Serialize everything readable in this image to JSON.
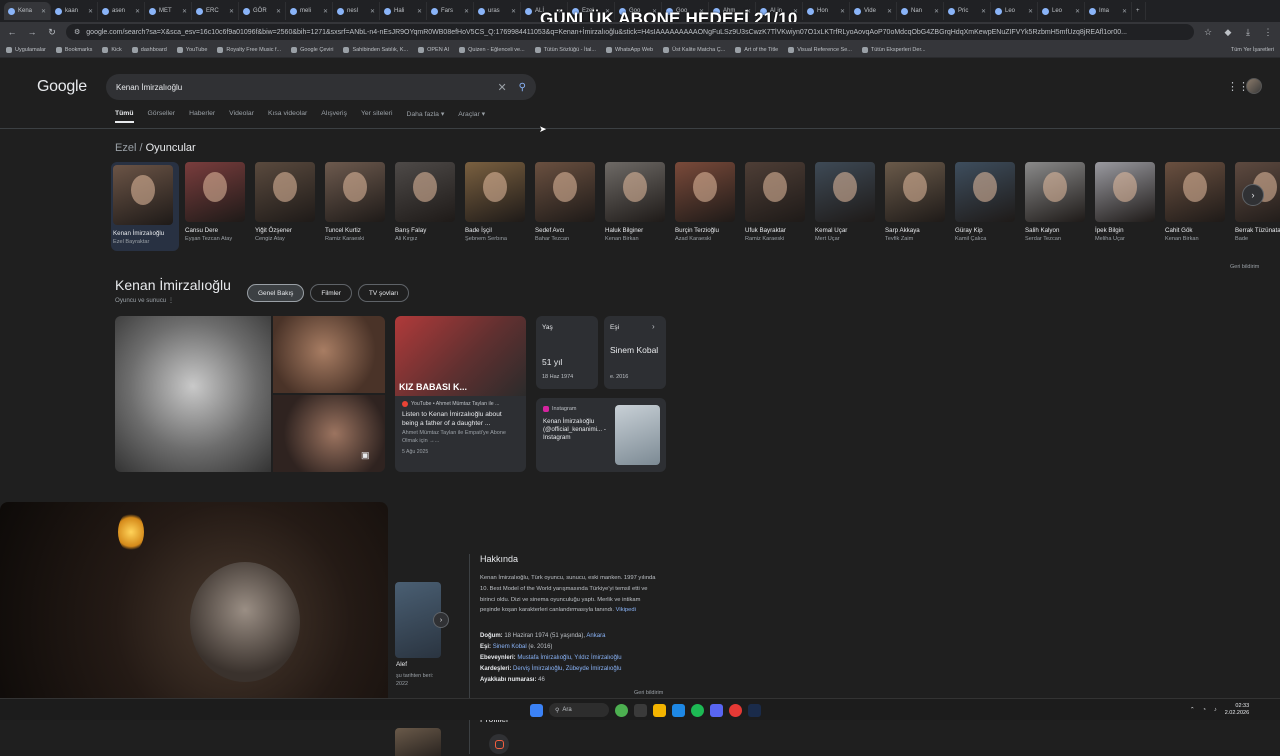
{
  "overlay": {
    "title": "GÜNLÜK ABONE HEDEFİ 21/10"
  },
  "browser": {
    "tabs": [
      "Kena",
      "kaan",
      "asen",
      "MET",
      "ERC",
      "GÖR",
      "meli",
      "nesl",
      "Hali",
      "Fars",
      "uras",
      "ALİ",
      "Ezel",
      "Goo",
      "Goo",
      "Ahm",
      "AI in",
      "Hon",
      "Vide",
      "Nan",
      "Pric",
      "Leo",
      "Leo",
      "Ima"
    ],
    "active_tab": 0,
    "url": "google.com/search?sa=X&sca_esv=16c10c6f9a01096f&biw=2560&bih=1271&sxsrf=ANbL-n4-nEsJR9OYqmR0WB08efHoV5CS_Q:1769984411053&q=Kenan+İmirzalıoğlu&stick=H4sIAAAAAAAAAONgFuLSz9U3sCwzK7TlVKwiyn07O1xLKTrfRLyoAovqAoP70oMdcqObG4ZBGrqHdqXmKewpENuZIFVYk5RzbmH5mfUzq8jREAfl1or00...",
    "bookmarks": [
      "Uygulamalar",
      "Bookmarks",
      "Kick",
      "dashboard",
      "YouTube",
      "Royalty Free Music f...",
      "Google Çeviri",
      "Sahibinden Satılık, K...",
      "OPEN AI",
      "Quizen - Eğlenceli ve...",
      "Tütün Sözlüğü - İtal...",
      "WhatsApp Web",
      "Üst Kalite Matcha Ç...",
      "Art of the Title",
      "Visual Reference Se...",
      "Tütün Eksperleri Der..."
    ],
    "all_bookmarks": "Tüm Yer İşaretleri"
  },
  "google": {
    "logo": "Google",
    "query": "Kenan İmirzalıoğlu",
    "nav_tabs": [
      "Tümü",
      "Görseller",
      "Haberler",
      "Videolar",
      "Kısa videolar",
      "Alışveriş",
      "Yer siteleri",
      "Daha fazla ▾",
      "Araçlar ▾"
    ]
  },
  "carousel": {
    "crumb": "Ezel",
    "title": "Oyuncular",
    "people": [
      {
        "name": "Kenan İmirzalıoğlu",
        "role": "Ezel Bayraktar"
      },
      {
        "name": "Cansu Dere",
        "role": "Eyşan Tezcan Atay"
      },
      {
        "name": "Yiğit Özşener",
        "role": "Cengiz Atay"
      },
      {
        "name": "Tuncel Kurtiz",
        "role": "Ramiz Karaeski"
      },
      {
        "name": "Barış Falay",
        "role": "Ali Kırgız"
      },
      {
        "name": "Bade İşçil",
        "role": "Şebnem Serbına"
      },
      {
        "name": "Sedef Avcı",
        "role": "Bahar Tezcan"
      },
      {
        "name": "Haluk Bilginer",
        "role": "Kenan Birkan"
      },
      {
        "name": "Burçin Terzioğlu",
        "role": "Azad Karaeski"
      },
      {
        "name": "Ufuk Bayraktar",
        "role": "Ramiz Karaeski"
      },
      {
        "name": "Kemal Uçar",
        "role": "Mert Uçar"
      },
      {
        "name": "Sarp Akkaya",
        "role": "Tevfik Zaim"
      },
      {
        "name": "Güray Kip",
        "role": "Kamil Çalıca"
      },
      {
        "name": "Salih Kalyon",
        "role": "Serdar Tezcan"
      },
      {
        "name": "İpek Bilgin",
        "role": "Meliha Uçar"
      },
      {
        "name": "Cahit Gök",
        "role": "Kenan Birkan"
      },
      {
        "name": "Berrak Tüzünataç",
        "role": "Bade"
      }
    ],
    "feedback": "Geri bildirim"
  },
  "panel": {
    "name": "Kenan İmirzalıoğlu",
    "subtitle": "Oyuncu ve sunucu",
    "chips": [
      "Genel Bakış",
      "Filmler",
      "TV şovları"
    ],
    "video": {
      "thumb_caption": "KIZ BABASI K...",
      "source": "YouTube • Ahmet Mümtaz Taylan ile ...",
      "title": "Listen to Kenan İmirzalıoğlu about being a father of a daughter ...",
      "desc": "Ahmet Mümtaz Taylan ile Empati'ye Abone Olmak için →...",
      "date": "5 Ağu 2025"
    },
    "age": {
      "label": "Yaş",
      "value": "51 yıl",
      "sub": "18 Haz 1974"
    },
    "spouse": {
      "label": "Eşi",
      "value": "Sinem Kobal",
      "sub": "e. 2016"
    },
    "instagram": {
      "label": "Instagram",
      "text": "Kenan İmirzalıoğlu (@official_kenanimi... - Instagram"
    }
  },
  "film": {
    "name": "Alef",
    "sub": "şu tarihten beri: 2022"
  },
  "about": {
    "heading": "Hakkında",
    "text": "Kenan İmirzalıoğlu, Türk oyuncu, sunucu, eski manken. 1997 yılında 10. Best Model of the World yarışmasında Türkiye'yi temsil etti ve birinci oldu. Dizi ve sinema oyunculuğu yaptı. Merlik ve intikam peşinde koşan karakterleri canlandırmasıyla tanındı.",
    "source": "Vikipedi",
    "facts": [
      {
        "k": "Doğum:",
        "v": "18 Haziran 1974 (51 yaşında), ",
        "link": "Ankara"
      },
      {
        "k": "Eşi:",
        "v": "",
        "link": "Sinem Kobal",
        "after": " (e. 2016)"
      },
      {
        "k": "Ebeveynleri:",
        "v": "",
        "link": "Mustafa İmirzalıoğlu, Yıldız İmirzalıoğlu"
      },
      {
        "k": "Kardeşleri:",
        "v": "",
        "link": "Derviş İmirzalıoğlu, Zübeyde İmirzalıoğlu"
      },
      {
        "k": "Ayakkabı numarası:",
        "v": "46",
        "link": ""
      }
    ],
    "feedback": "Geri bildirim",
    "profiles": "Profiller"
  },
  "taskbar": {
    "search": "Ara",
    "time": "02:33",
    "date": "2.02.2026"
  }
}
